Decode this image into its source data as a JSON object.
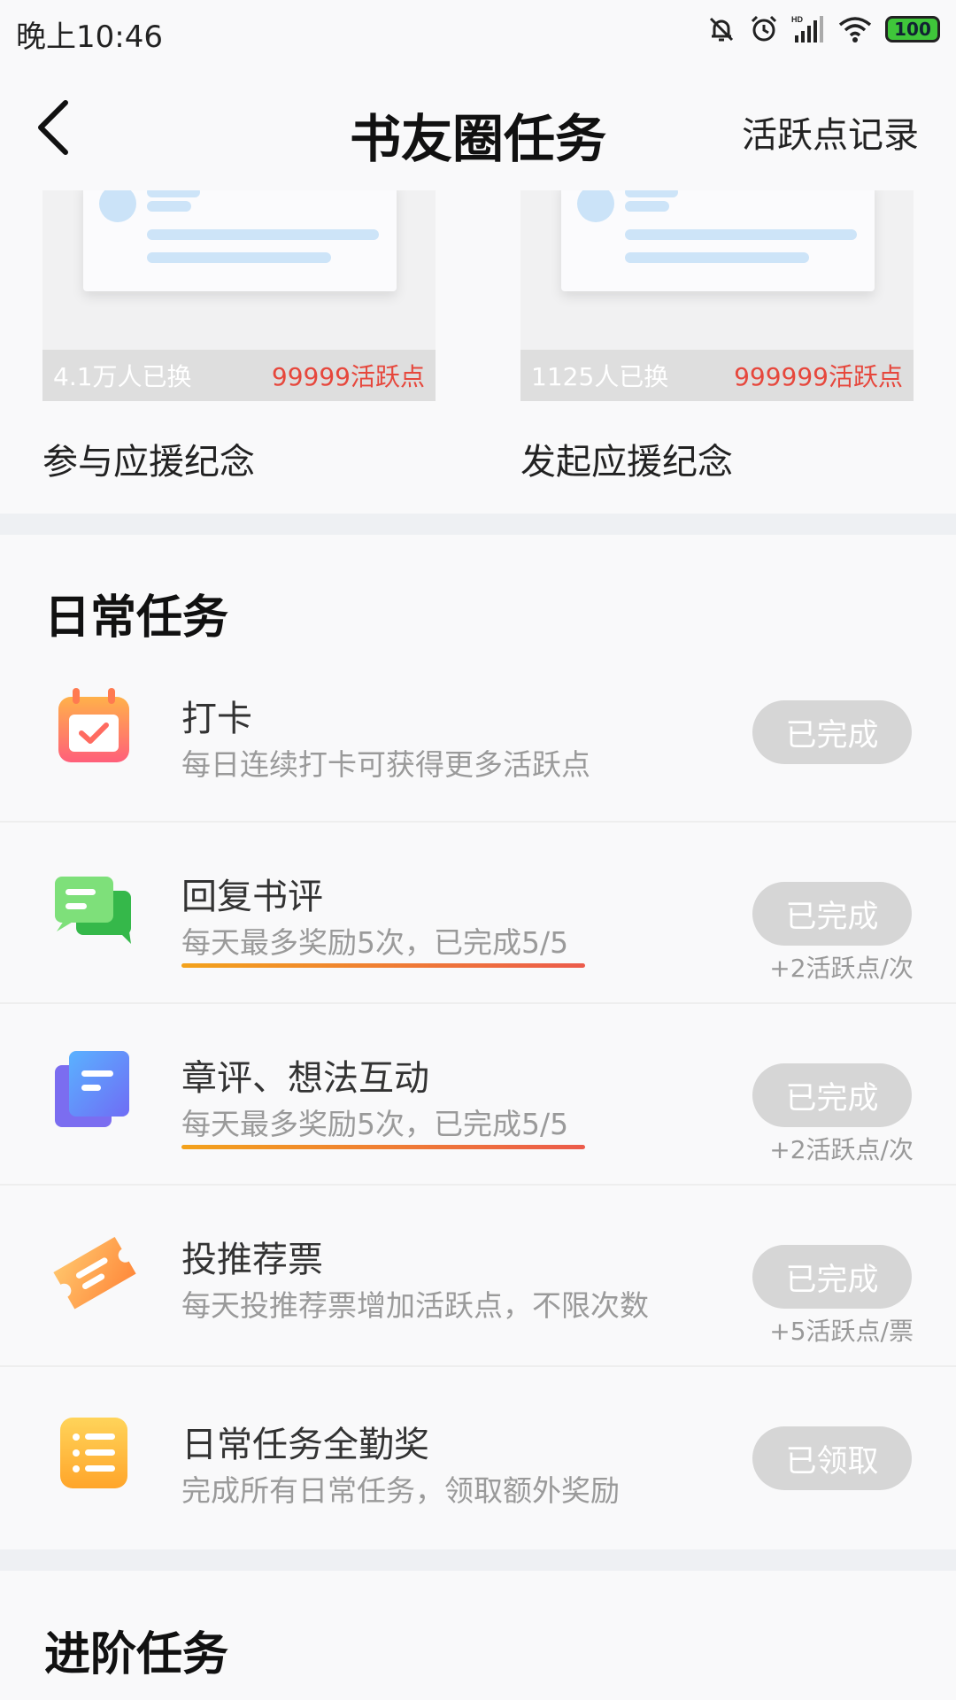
{
  "status_bar": {
    "time": "晚上10:46",
    "battery": "100"
  },
  "nav": {
    "title": "书友圈任务",
    "record_link": "活跃点记录"
  },
  "cards": [
    {
      "swapped": "4.1万人已换",
      "points": "99999活跃点",
      "name": "参与应援纪念"
    },
    {
      "swapped": "1125人已换",
      "points": "999999活跃点",
      "name": "发起应援纪念"
    }
  ],
  "daily": {
    "title": "日常任务",
    "tasks": [
      {
        "name": "打卡",
        "desc": "每日连续打卡可获得更多活跃点",
        "button": "已完成",
        "reward": ""
      },
      {
        "name": "回复书评",
        "desc": "每天最多奖励5次，已完成5/5",
        "button": "已完成",
        "reward": "+2活跃点/次"
      },
      {
        "name": "章评、想法互动",
        "desc": "每天最多奖励5次，已完成5/5",
        "button": "已完成",
        "reward": "+2活跃点/次"
      },
      {
        "name": "投推荐票",
        "desc": "每天投推荐票增加活跃点，不限次数",
        "button": "已完成",
        "reward": "+5活跃点/票"
      },
      {
        "name": "日常任务全勤奖",
        "desc": "完成所有日常任务，领取额外奖励",
        "button": "已领取",
        "reward": ""
      }
    ]
  },
  "advanced": {
    "title": "进阶任务"
  }
}
